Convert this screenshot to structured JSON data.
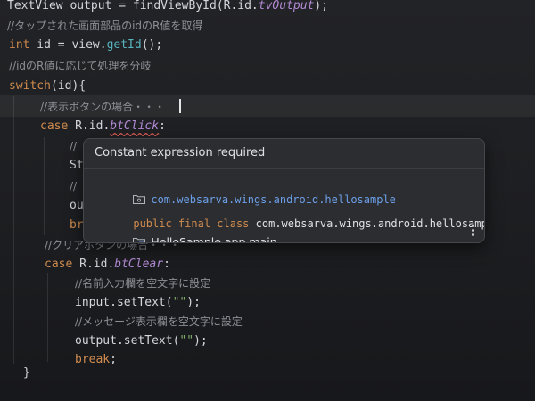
{
  "editor": {
    "lines": [
      {
        "id": "l1",
        "segments": [
          {
            "t": "TextView output = findViewById(R.id.",
            "c": ""
          },
          {
            "t": "tvOutput",
            "c": "fld"
          },
          {
            "t": ");",
            "c": ""
          }
        ]
      },
      {
        "id": "l2",
        "comment": "//タップされた画面部品のidのR値を取得"
      },
      {
        "id": "l3",
        "segments": [
          {
            "t": "int",
            "c": "kw"
          },
          {
            "t": " id = view.",
            "c": ""
          },
          {
            "t": "getId",
            "c": "meth"
          },
          {
            "t": "();",
            "c": ""
          }
        ]
      },
      {
        "id": "l4",
        "comment": "//idのR値に応じて処理を分岐"
      },
      {
        "id": "l5",
        "segments": [
          {
            "t": "switch",
            "c": "kw"
          },
          {
            "t": "(id){",
            "c": ""
          }
        ]
      },
      {
        "id": "l6",
        "comment": "//表示ボタンの場合・・・"
      },
      {
        "id": "l7",
        "segments": [
          {
            "t": "case",
            "c": "kw"
          },
          {
            "t": " R.id.",
            "c": ""
          },
          {
            "t": "btClick",
            "c": "fld-under"
          },
          {
            "t": ":",
            "c": ""
          }
        ]
      },
      {
        "id": "l8",
        "segments": [
          {
            "t": "//",
            "c": "cm"
          }
        ]
      },
      {
        "id": "l9",
        "segments": [
          {
            "t": "St",
            "c": ""
          }
        ]
      },
      {
        "id": "l10",
        "segments": [
          {
            "t": "//",
            "c": "cm"
          }
        ]
      },
      {
        "id": "l11",
        "segments": [
          {
            "t": "ou",
            "c": ""
          }
        ]
      },
      {
        "id": "l12",
        "segments": [
          {
            "t": "br",
            "c": "kw"
          }
        ]
      },
      {
        "id": "l13",
        "comment": "//クリアボタンの場合・・・"
      },
      {
        "id": "l14",
        "segments": [
          {
            "t": "case",
            "c": "kw"
          },
          {
            "t": " R.id.",
            "c": ""
          },
          {
            "t": "btClear",
            "c": "fld"
          },
          {
            "t": ":",
            "c": ""
          }
        ]
      },
      {
        "id": "l15",
        "comment": "//名前入力欄を空文字に設定"
      },
      {
        "id": "l16",
        "segments": [
          {
            "t": "input.",
            "c": ""
          },
          {
            "t": "setText",
            "c": ""
          },
          {
            "t": "(",
            "c": ""
          },
          {
            "t": "\"\"",
            "c": "str"
          },
          {
            "t": ");",
            "c": ""
          }
        ]
      },
      {
        "id": "l17",
        "comment": "//メッセージ表示欄を空文字に設定"
      },
      {
        "id": "l18",
        "segments": [
          {
            "t": "output.",
            "c": ""
          },
          {
            "t": "setText",
            "c": ""
          },
          {
            "t": "(",
            "c": ""
          },
          {
            "t": "\"\"",
            "c": "str"
          },
          {
            "t": ");",
            "c": ""
          }
        ]
      },
      {
        "id": "l19",
        "segments": [
          {
            "t": "break",
            "c": "kw"
          },
          {
            "t": ";",
            "c": ""
          }
        ]
      },
      {
        "id": "l20",
        "segments": [
          {
            "t": "}",
            "c": ""
          }
        ]
      }
    ]
  },
  "popup": {
    "title": "Constant expression required",
    "package_link": "com.websarva.wings.android.hellosample",
    "class_keywords": "public final class",
    "class_name": "com.websarva.wings.android.hellosample.R",
    "module": "HelloSample.app.main",
    "icons": [
      "package-folder-icon",
      "module-folder-icon",
      "more-options-icon"
    ]
  },
  "colors": {
    "keyword": "#d08b4e",
    "field": "#b28ad4",
    "link": "#6d9fe8",
    "error_underline": "#e05b56"
  }
}
